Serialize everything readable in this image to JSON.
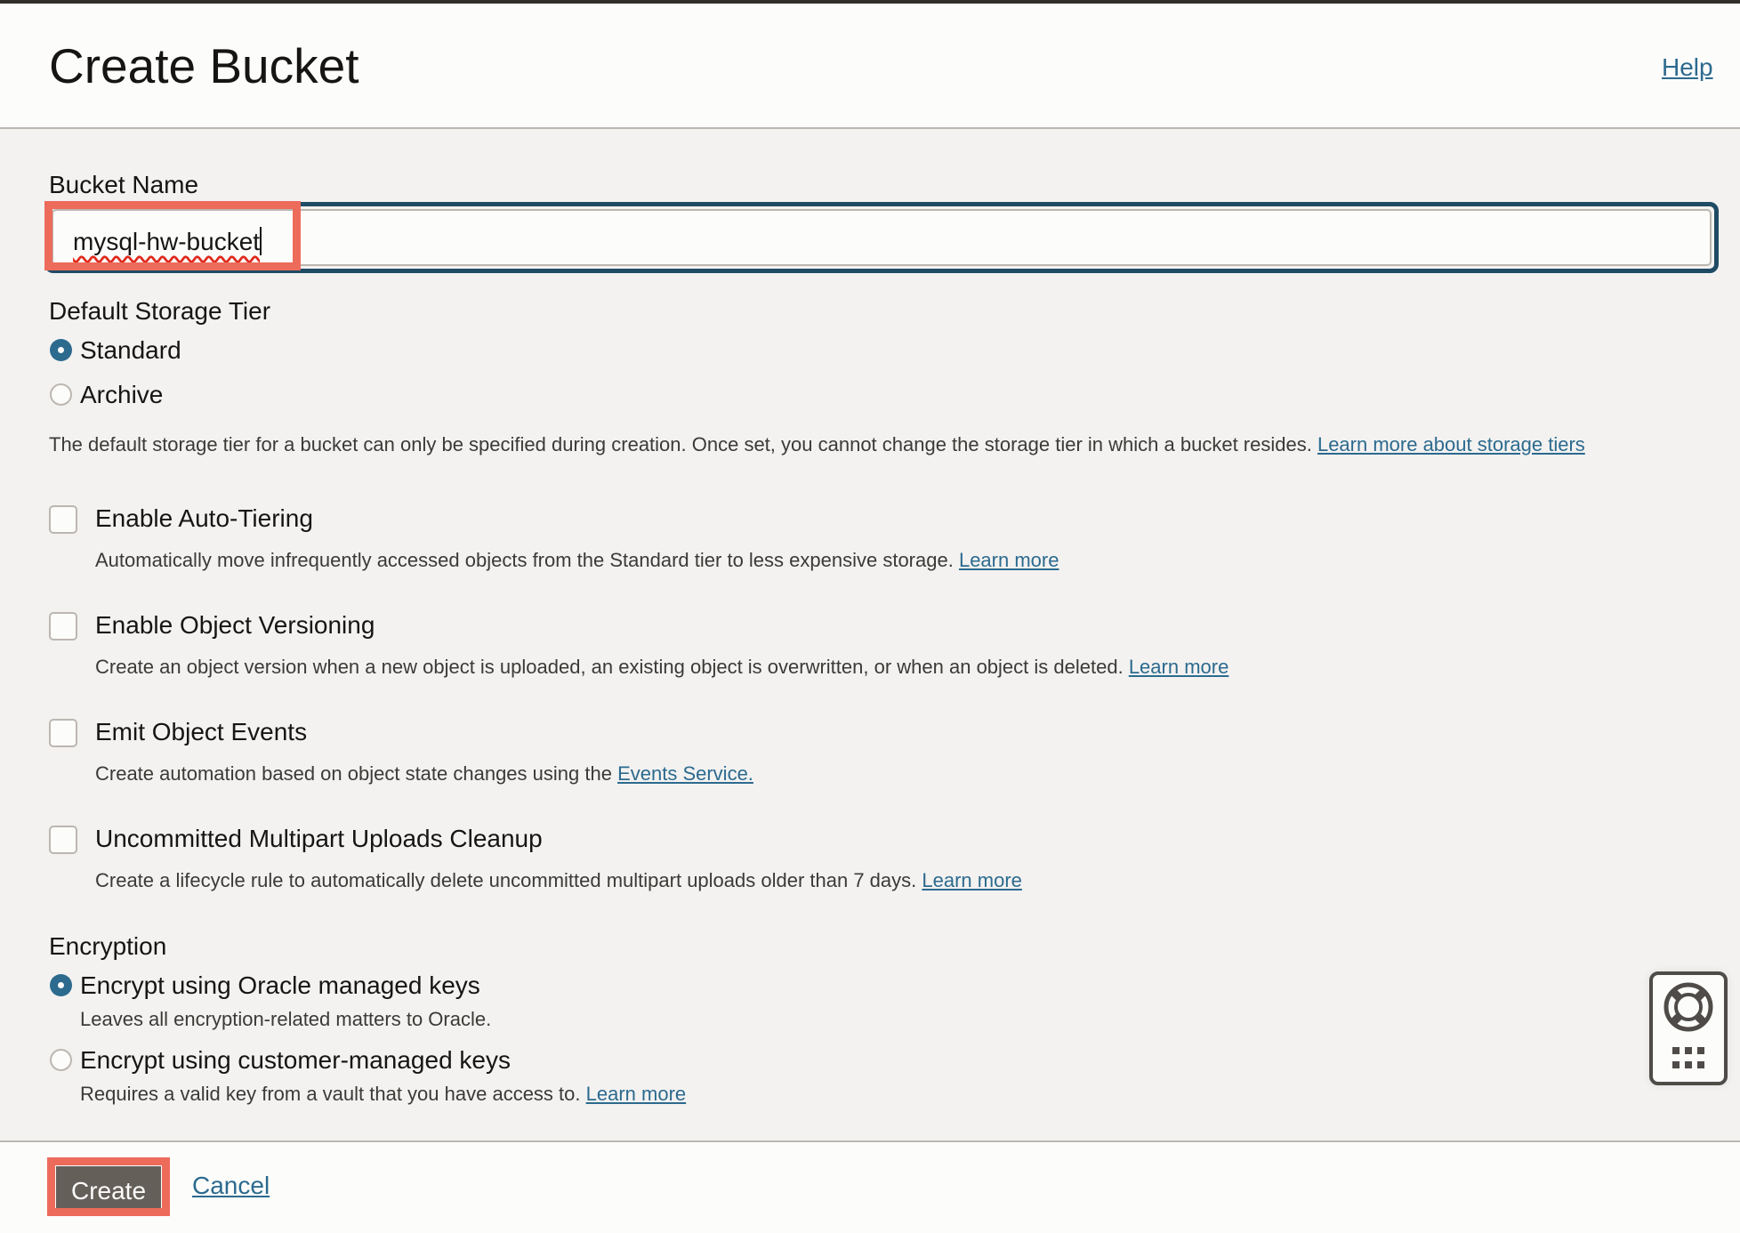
{
  "header": {
    "title": "Create Bucket",
    "help_link": "Help"
  },
  "bucket_name": {
    "label": "Bucket Name",
    "value": "mysql-hw-bucket"
  },
  "storage_tier": {
    "label": "Default Storage Tier",
    "options": [
      {
        "label": "Standard",
        "selected": true
      },
      {
        "label": "Archive",
        "selected": false
      }
    ],
    "description": "The default storage tier for a bucket can only be specified during creation. Once set, you cannot change the storage tier in which a bucket resides.",
    "link": "Learn more about storage tiers"
  },
  "options": [
    {
      "label": "Enable Auto-Tiering",
      "checked": false,
      "description": "Automatically move infrequently accessed objects from the Standard tier to less expensive storage.",
      "link": "Learn more"
    },
    {
      "label": "Enable Object Versioning",
      "checked": false,
      "description": "Create an object version when a new object is uploaded, an existing object is overwritten, or when an object is deleted.",
      "link": "Learn more"
    },
    {
      "label": "Emit Object Events",
      "checked": false,
      "description": "Create automation based on object state changes using the",
      "link": "Events Service."
    },
    {
      "label": "Uncommitted Multipart Uploads Cleanup",
      "checked": false,
      "description": "Create a lifecycle rule to automatically delete uncommitted multipart uploads older than 7 days.",
      "link": "Learn more"
    }
  ],
  "encryption": {
    "label": "Encryption",
    "options": [
      {
        "label": "Encrypt using Oracle managed keys",
        "selected": true,
        "description": "Leaves all encryption-related matters to Oracle.",
        "link": ""
      },
      {
        "label": "Encrypt using customer-managed keys",
        "selected": false,
        "description": "Requires a valid key from a vault that you have access to.",
        "link": "Learn more"
      }
    ]
  },
  "footer": {
    "create_label": "Create",
    "cancel_label": "Cancel"
  },
  "help_widget": {
    "icons": [
      "lifebuoy-icon",
      "grid-dots-icon"
    ]
  },
  "colors": {
    "accent": "#2c6a8e",
    "focus_border": "#1f4b64",
    "annotation": "#ed6b5b",
    "button_bg": "#655f5a"
  }
}
